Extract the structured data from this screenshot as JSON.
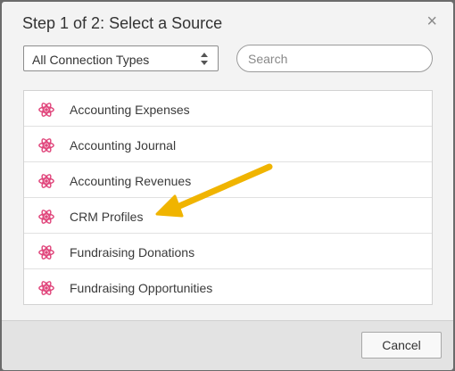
{
  "dialog": {
    "title": "Step 1 of 2: Select a Source",
    "close_symbol": "×"
  },
  "filter": {
    "connection_type": "All Connection Types"
  },
  "search": {
    "placeholder": "Search",
    "value": ""
  },
  "sources": [
    {
      "label": "Accounting Expenses",
      "icon": "atom-icon"
    },
    {
      "label": "Accounting Journal",
      "icon": "atom-icon"
    },
    {
      "label": "Accounting Revenues",
      "icon": "atom-icon"
    },
    {
      "label": "CRM Profiles",
      "icon": "atom-icon"
    },
    {
      "label": "Fundraising Donations",
      "icon": "atom-icon"
    },
    {
      "label": "Fundraising Opportunities",
      "icon": "atom-icon"
    }
  ],
  "footer": {
    "cancel_label": "Cancel"
  },
  "colors": {
    "icon": "#e0457b",
    "annotation_arrow": "#f0b400"
  }
}
